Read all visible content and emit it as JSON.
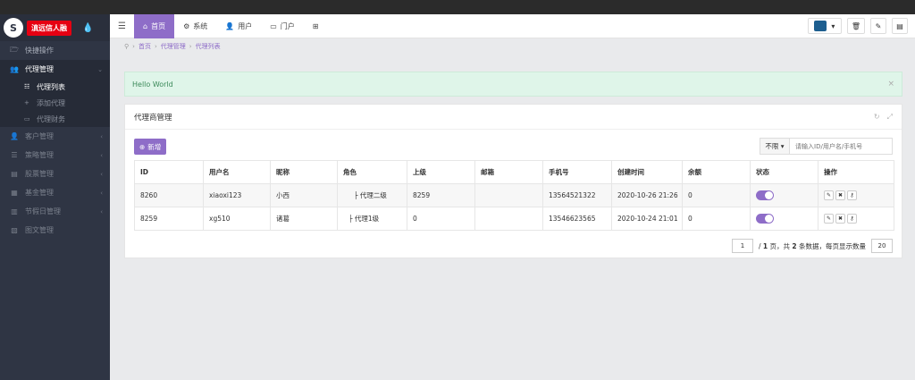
{
  "brand": {
    "logo_text": "滇远信人融"
  },
  "sidebar": {
    "items": [
      {
        "label": "快捷操作",
        "icon": "folder-open-icon",
        "glyph": "🗁"
      },
      {
        "label": "代理管理",
        "icon": "users-icon",
        "glyph": "👥"
      },
      {
        "label": "客户管理",
        "icon": "user-icon",
        "glyph": "👤"
      },
      {
        "label": "策略管理",
        "icon": "list-icon",
        "glyph": "☰"
      },
      {
        "label": "股票管理",
        "icon": "stock-icon",
        "glyph": "▤"
      },
      {
        "label": "基金管理",
        "icon": "fund-icon",
        "glyph": "▦"
      },
      {
        "label": "节假日管理",
        "icon": "calendar-icon",
        "glyph": "▥"
      },
      {
        "label": "图文管理",
        "icon": "image-icon",
        "glyph": "▧"
      }
    ],
    "submenu": [
      {
        "label": "代理列表"
      },
      {
        "label": "添加代理"
      },
      {
        "label": "代理财务"
      }
    ]
  },
  "header": {
    "tabs": [
      {
        "label": "首页"
      },
      {
        "label": "系统"
      },
      {
        "label": "用户"
      },
      {
        "label": "门户"
      }
    ]
  },
  "breadcrumb": [
    "首页",
    "代理管理",
    "代理列表"
  ],
  "alert": {
    "text": "Hello World"
  },
  "panel": {
    "title": "代理商管理"
  },
  "toolbar": {
    "add_label": "新增",
    "filter_label": "不限 ▾",
    "search_placeholder": "请输入ID/用户名/手机号"
  },
  "table": {
    "headers": [
      "ID",
      "用户名",
      "昵称",
      "角色",
      "上级",
      "邮箱",
      "手机号",
      "创建时间",
      "余额",
      "状态",
      "操作"
    ],
    "rows": [
      {
        "id": "8260",
        "username": "xiaoxi123",
        "nickname": "小西",
        "role": "├ 代理二级",
        "parent": "8259",
        "email": "",
        "phone": "13564521322",
        "created": "2020-10-26 21:26",
        "balance": "0"
      },
      {
        "id": "8259",
        "username": "xg510",
        "nickname": "诸葛",
        "role": "├ 代理1级",
        "parent": "0",
        "email": "",
        "phone": "13546623565",
        "created": "2020-10-24 21:01",
        "balance": "0"
      }
    ]
  },
  "pager": {
    "page": "1",
    "text_a": "/ ",
    "total_pages": "1",
    "text_b": " 页，共 ",
    "total_records": "2",
    "text_c": " 条数据，每页显示数量",
    "page_size": "20"
  },
  "colors": {
    "accent": "#8e6dc8",
    "sidebar": "#2f3544"
  }
}
